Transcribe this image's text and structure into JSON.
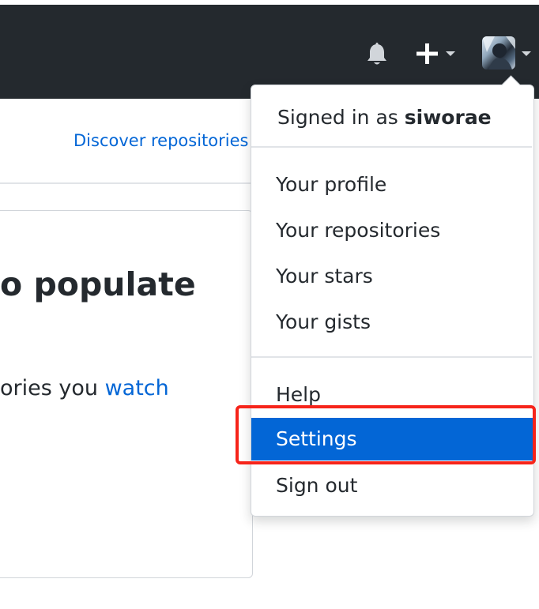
{
  "header": {
    "bell_icon": "bell-icon",
    "plus_icon": "plus-icon",
    "avatar_alt": "user avatar"
  },
  "page": {
    "discover_link": "Discover repositories",
    "heading_fragment": "o populate",
    "subtext_fragment": "ories you ",
    "subtext_link": "watch"
  },
  "dropdown": {
    "signed_in_prefix": "Signed in as ",
    "username": "siworae",
    "items": [
      {
        "label": "Your profile"
      },
      {
        "label": "Your repositories"
      },
      {
        "label": "Your stars"
      },
      {
        "label": "Your gists"
      },
      {
        "label": "Help"
      },
      {
        "label": "Settings"
      },
      {
        "label": "Sign out"
      }
    ]
  },
  "colors": {
    "header_bg": "#24292e",
    "link": "#0366d6",
    "active_bg": "#0366d6",
    "highlight_border": "#f6241a"
  }
}
